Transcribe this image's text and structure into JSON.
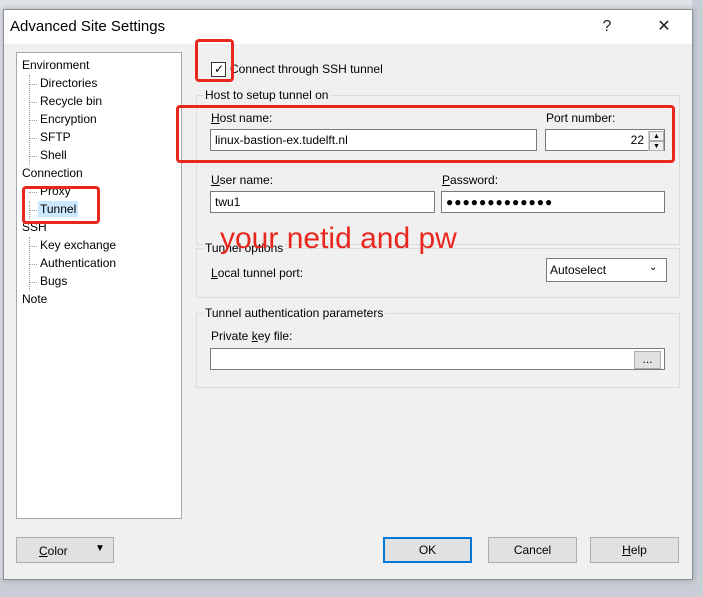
{
  "dialog": {
    "title": "Advanced Site Settings",
    "help_glyph": "?",
    "close_glyph": "✕"
  },
  "tree": {
    "items": [
      {
        "label": "Environment",
        "level": 0
      },
      {
        "label": "Directories",
        "level": 1
      },
      {
        "label": "Recycle bin",
        "level": 1
      },
      {
        "label": "Encryption",
        "level": 1
      },
      {
        "label": "SFTP",
        "level": 1
      },
      {
        "label": "Shell",
        "level": 1
      },
      {
        "label": "Connection",
        "level": 0
      },
      {
        "label": "Proxy",
        "level": 1
      },
      {
        "label": "Tunnel",
        "level": 1,
        "selected": true
      },
      {
        "label": "SSH",
        "level": 0
      },
      {
        "label": "Key exchange",
        "level": 1
      },
      {
        "label": "Authentication",
        "level": 1
      },
      {
        "label": "Bugs",
        "level": 1
      },
      {
        "label": "Note",
        "level": 0
      }
    ]
  },
  "tunnel": {
    "connect_label": "Connect through SSH tunnel",
    "connect_checked": true,
    "host_group_title": "Host to setup tunnel on",
    "host_label": "Host name:",
    "host_value": "linux-bastion-ex.tudelft.nl",
    "port_label": "Port number:",
    "port_value": "22",
    "user_label": "User name:",
    "user_value": "twu1",
    "password_label": "Password:",
    "password_value": "●●●●●●●●●●●●●",
    "options_group_title": "Tunnel options",
    "local_port_label": "Local tunnel port:",
    "local_port_value": "Autoselect",
    "auth_group_title": "Tunnel authentication parameters",
    "private_key_label": "Private key file:",
    "private_key_value": "",
    "browse_label": "..."
  },
  "footer": {
    "color_label": "Color",
    "ok_label": "OK",
    "cancel_label": "Cancel",
    "help_label": "Help"
  },
  "annotation": {
    "text": "your netid and pw",
    "color": "#e8271f"
  }
}
